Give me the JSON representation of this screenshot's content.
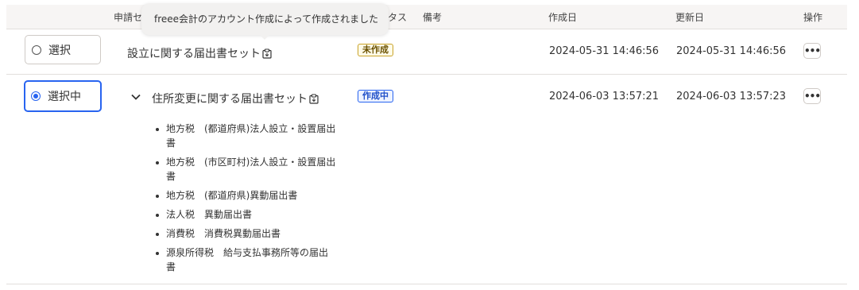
{
  "header": {
    "application_set": "申請セ",
    "status": "タス",
    "notes": "備考",
    "created": "作成日",
    "updated": "更新日",
    "actions": "操作"
  },
  "tooltip": {
    "text": "freee会計のアカウント作成によって作成されました"
  },
  "rows": [
    {
      "select_label": "選択",
      "selected": false,
      "name": "設立に関する届出書セット",
      "status_badge": "未作成",
      "created": "2024-05-31 14:46:56",
      "updated": "2024-05-31 14:46:56",
      "menu_icon": "ellipsis-icon",
      "menu_glyph": "•••"
    },
    {
      "select_label": "選択中",
      "selected": true,
      "expanded": true,
      "name": "住所変更に関する届出書セット",
      "status_badge": "作成中",
      "created": "2024-06-03 13:57:21",
      "updated": "2024-06-03 13:57:23",
      "menu_icon": "ellipsis-icon",
      "menu_glyph": "•••",
      "documents": [
        "地方税　(都道府県)法人設立・設置届出書",
        "地方税　(市区町村)法人設立・設置届出書",
        "地方税　(都道府県)異動届出書",
        "法人税　異動届出書",
        "消費税　消費税異動届出書",
        "源泉所得税　給与支払事務所等の届出書"
      ]
    }
  ],
  "colors": {
    "accent": "#2864f0",
    "header_bg": "#f7f5f4",
    "pending_badge": "#c9a32a",
    "in_progress_badge": "#2864f0"
  },
  "icons": [
    "radio-unchecked-icon",
    "radio-checked-icon",
    "clipboard-icon",
    "chevron-down-icon",
    "ellipsis-icon"
  ]
}
